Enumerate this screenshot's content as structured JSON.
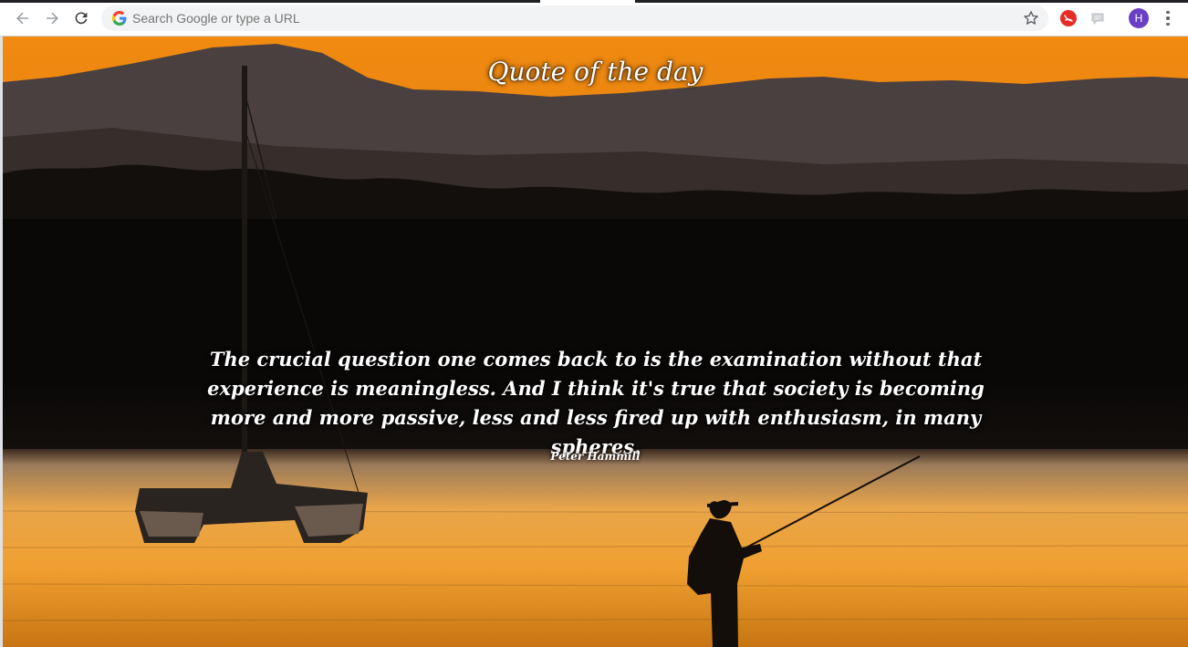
{
  "browser": {
    "omnibox_placeholder": "Search Google or type a URL",
    "profile_initial": "H",
    "icons": {
      "back": "arrow-left-icon",
      "forward": "arrow-right-icon",
      "reload": "reload-icon",
      "google": "google-g-icon",
      "bookmark": "star-icon",
      "extension_1": "red-extension-icon",
      "extension_2": "chat-extension-icon",
      "menu": "three-dots-menu-icon"
    },
    "colors": {
      "avatar": "#6b3fc4",
      "extension_1": "#e52d27"
    }
  },
  "page": {
    "title": "Quote of the day",
    "quote": "The crucial question one comes back to is the examination without that experience is meaningless. And I think it's true that society is becoming more and more passive, less and less fired up with enthusiasm, in many spheres.",
    "author": "Peter Hammill",
    "background": "sunset-lake-fisherman-sailboat-photo"
  }
}
